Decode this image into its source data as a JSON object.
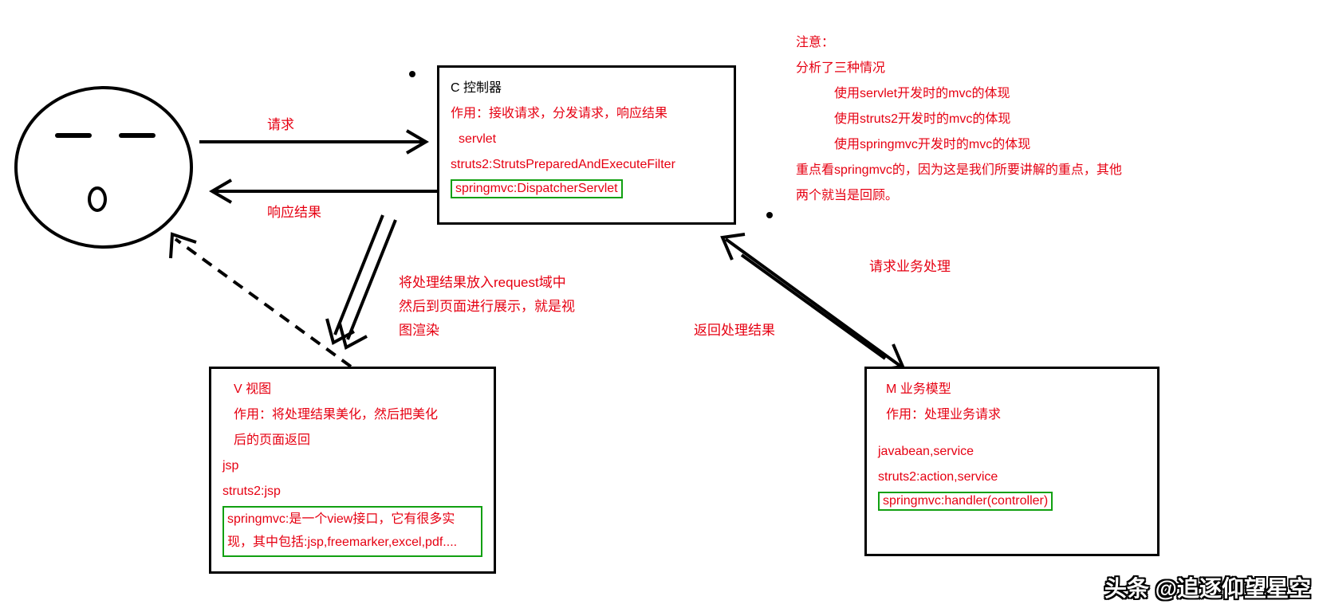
{
  "arrows": {
    "request": "请求",
    "response": "响应结果",
    "to_view_l1": "将处理结果放入request域中",
    "to_view_l2": "然后到页面进行展示，就是视",
    "to_view_l3": "图渲染",
    "request_biz": "请求业务处理",
    "return_result": "返回处理结果"
  },
  "controller": {
    "title": "C 控制器",
    "role": "作用：接收请求，分发请求，响应结果",
    "servlet": "servlet",
    "struts2": "struts2:StrutsPreparedAndExecuteFilter",
    "springmvc": "springmvc:DispatcherServlet"
  },
  "view": {
    "title": "V 视图",
    "role_l1": "作用：将处理结果美化，然后把美化",
    "role_l2": "后的页面返回",
    "jsp": "jsp",
    "struts2": "struts2:jsp",
    "springmvc_l1": "springmvc:是一个view接口，它有很多实",
    "springmvc_l2": "现，其中包括:jsp,freemarker,excel,pdf...."
  },
  "model": {
    "title": "M 业务模型",
    "role": "作用：处理业务请求",
    "javabean": "javabean,service",
    "struts2": "struts2:action,service",
    "springmvc": "springmvc:handler(controller)"
  },
  "notes": {
    "l1": "注意：",
    "l2": "分析了三种情况",
    "l3": "使用servlet开发时的mvc的体现",
    "l4": "使用struts2开发时的mvc的体现",
    "l5": "使用springmvc开发时的mvc的体现",
    "l6": "重点看springmvc的，因为这是我们所要讲解的重点，其他",
    "l7": "两个就当是回顾。"
  },
  "watermark": "头条 @追逐仰望星空"
}
